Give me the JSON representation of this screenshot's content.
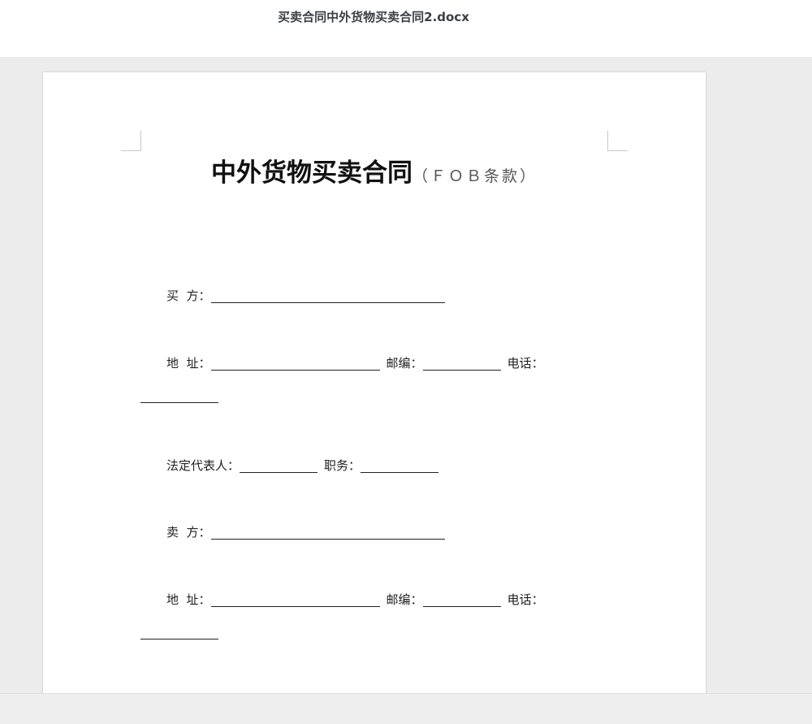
{
  "window": {
    "doc_title": "买卖合同中外货物买卖合同2.docx"
  },
  "document": {
    "heading_main": "中外货物买卖合同",
    "heading_sub": "（ＦＯＢ条款）",
    "buyer_label": "买  方：",
    "address_label": "地  址：",
    "postcode_label": "邮编：",
    "phone_label": "电话：",
    "legal_rep_label": "法定代表人：",
    "position_label": "职务：",
    "seller_label": "卖  方："
  }
}
